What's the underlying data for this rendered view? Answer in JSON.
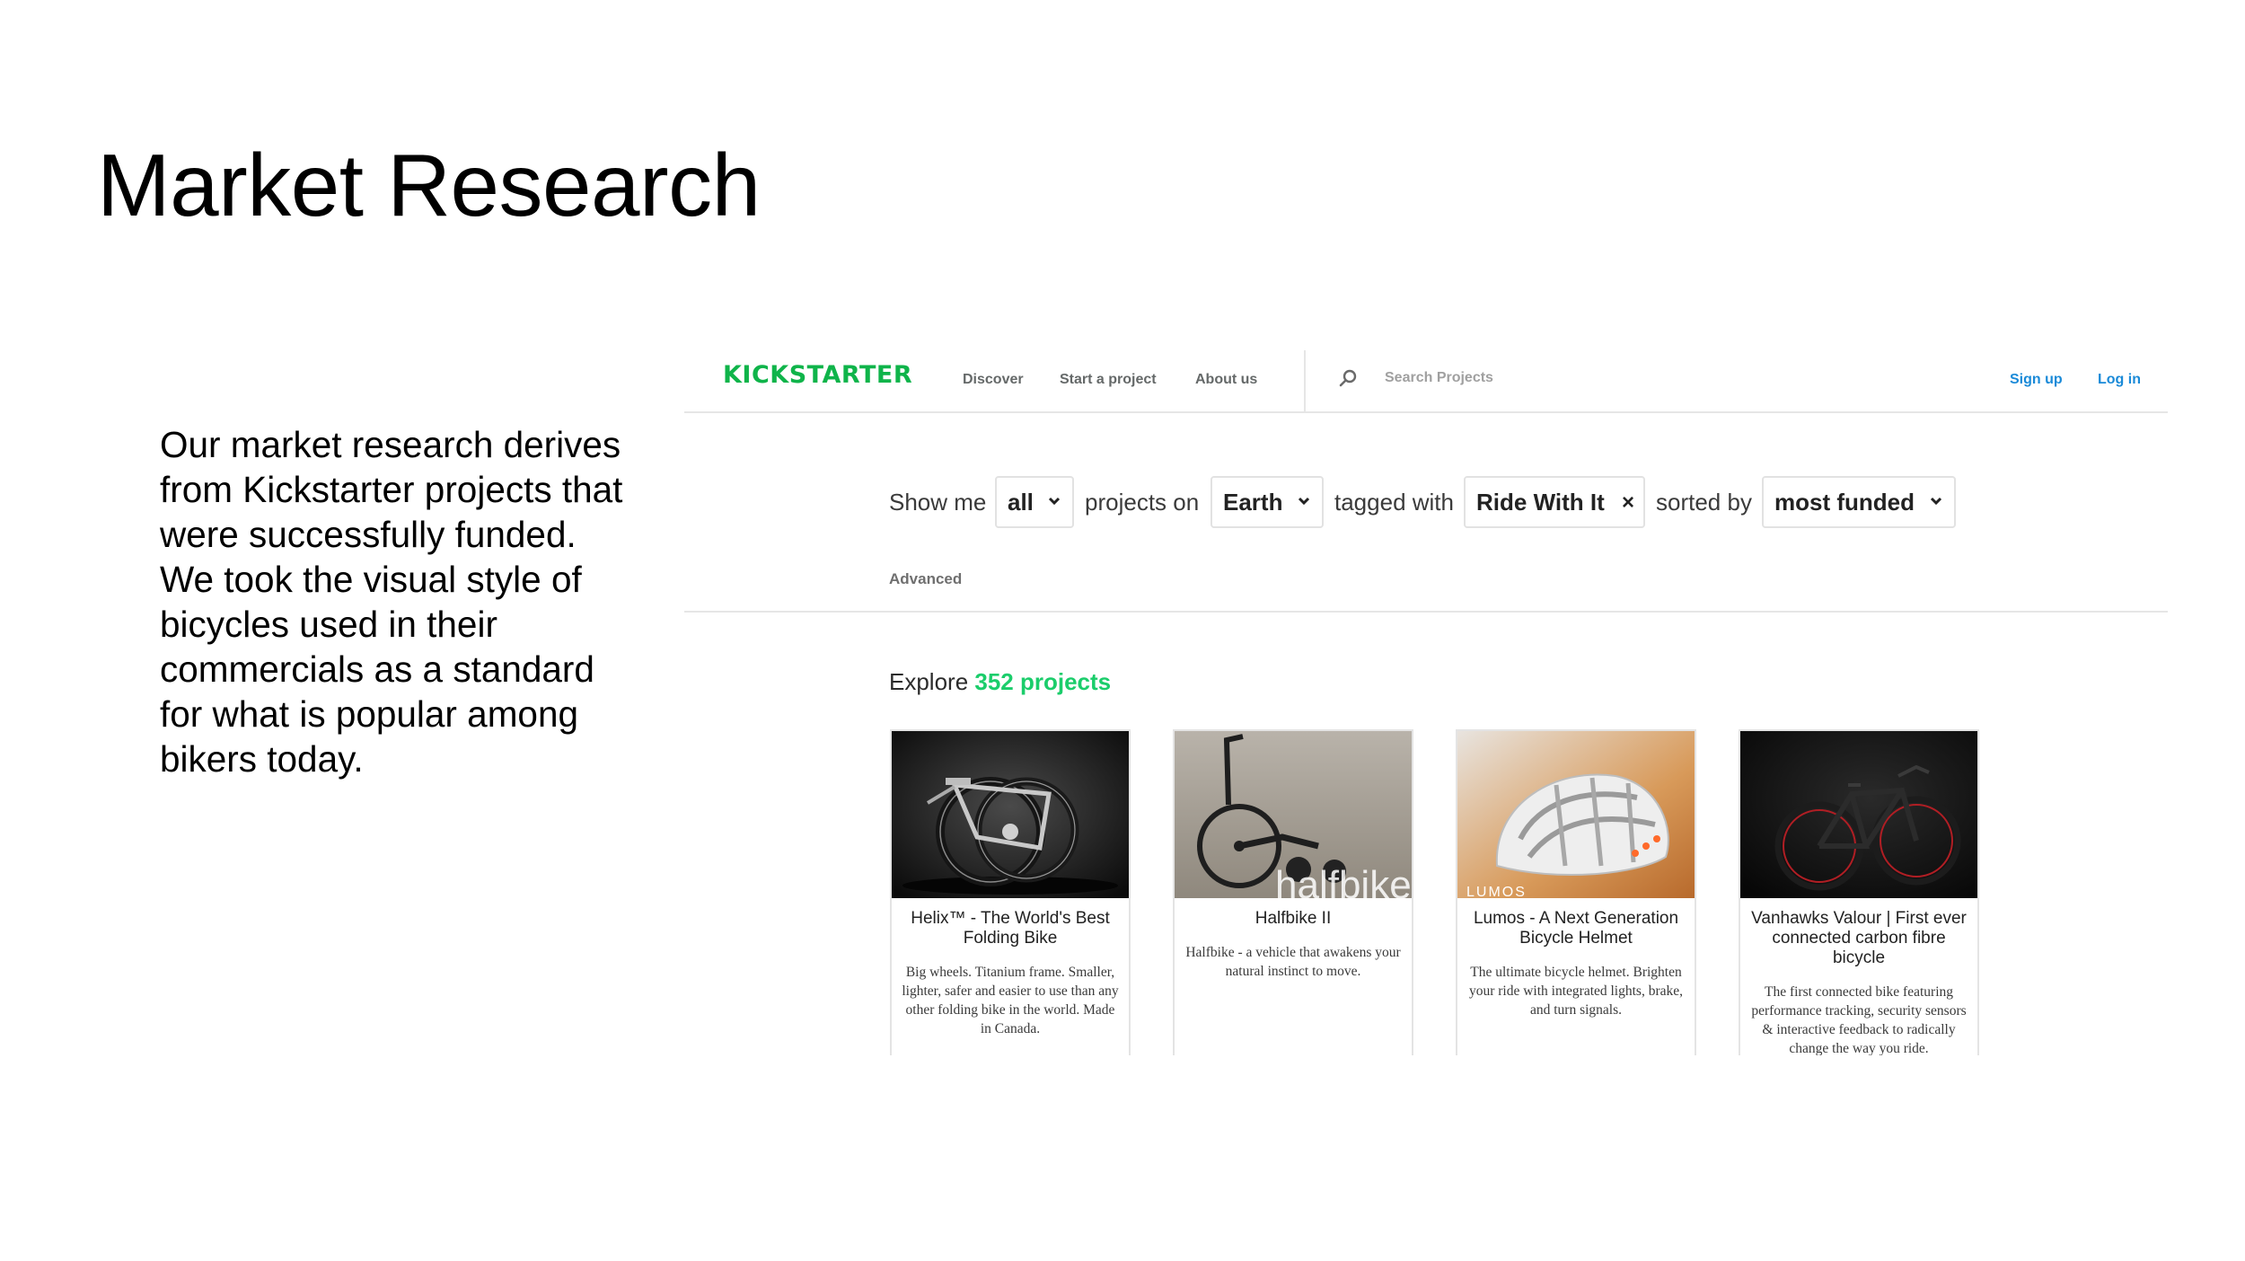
{
  "slide": {
    "title": "Market Research",
    "body": "Our market research derives from Kickstarter projects that were successfully funded. We took the visual style of bicycles used in their commercials as a standard for what is popular among bikers today."
  },
  "kickstarter": {
    "logo_part1": "KICK",
    "logo_part2": "STARTER",
    "nav": {
      "discover": "Discover",
      "start_project": "Start a project",
      "about_us": "About us"
    },
    "search": {
      "placeholder": "Search Projects",
      "icon": "search-icon"
    },
    "auth": {
      "sign_up": "Sign up",
      "log_in": "Log in"
    },
    "filters": {
      "show_me": "Show me",
      "category_value": "all",
      "projects_on": "projects on",
      "location_value": "Earth",
      "tagged_with": "tagged with",
      "tag_value": "Ride With It",
      "tag_remove": "×",
      "sorted_by": "sorted by",
      "sort_value": "most funded",
      "advanced": "Advanced"
    },
    "explore": {
      "prefix": "Explore",
      "count_text": "352 projects"
    },
    "projects": [
      {
        "title": "Helix™ - The World's Best Folding Bike",
        "blurb": "Big wheels. Titanium frame. Smaller, lighter, safer and easier to use than any other folding bike in the world. Made in Canada."
      },
      {
        "title": "Halfbike II",
        "blurb": "Halfbike - a vehicle that awakens your natural instinct to move.",
        "image_text": "halfbike"
      },
      {
        "title": "Lumos - A Next Generation Bicycle Helmet",
        "blurb": "The ultimate bicycle helmet. Brighten your ride with integrated lights, brake, and turn signals.",
        "image_text": "LUMOS"
      },
      {
        "title": "Vanhawks Valour | First ever connected carbon fibre bicycle",
        "blurb": "The first connected bike featuring performance tracking, security sensors & interactive feedback to radically change the way you ride."
      }
    ],
    "colors": {
      "brand_green": "#0fb44a",
      "count_green": "#1bcd6b",
      "link_blue": "#1a8ad8"
    }
  }
}
